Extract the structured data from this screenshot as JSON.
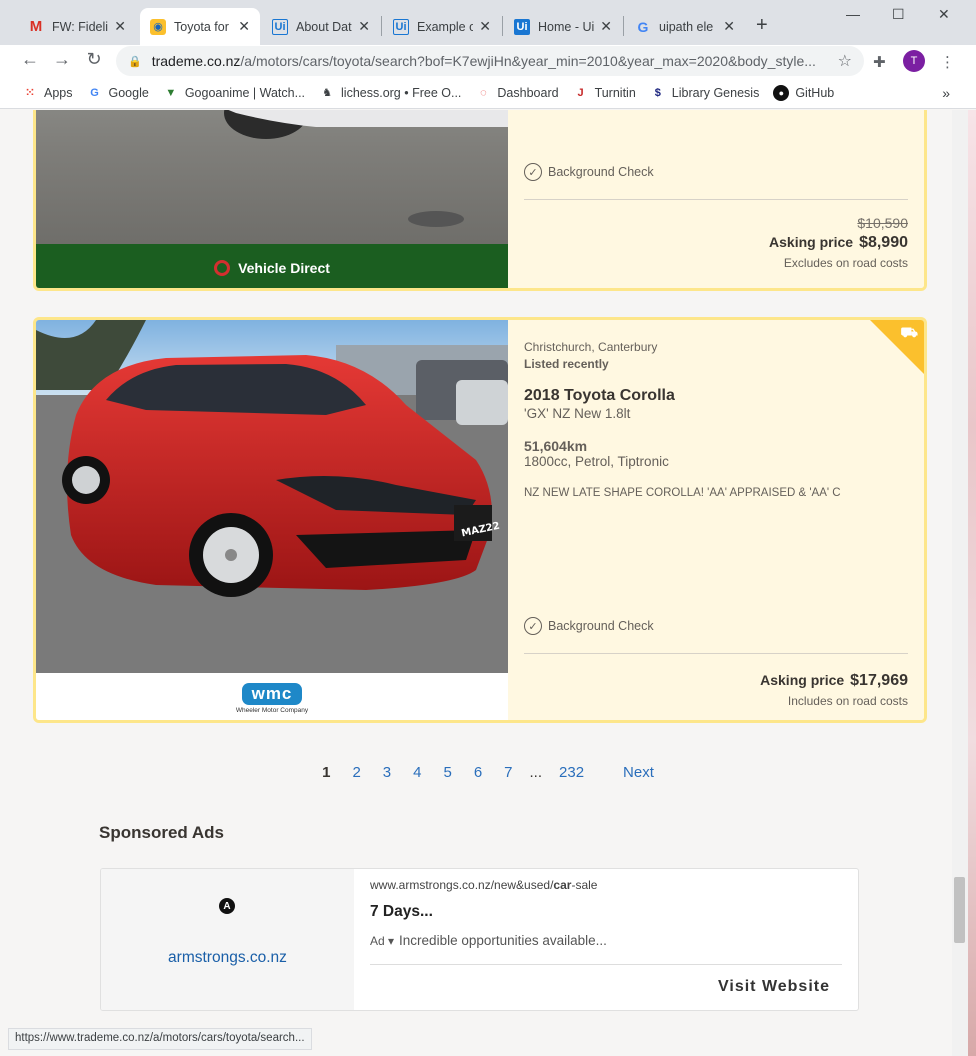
{
  "browser": {
    "tabs": [
      {
        "title": "FW: Fidelity",
        "favicon": "gmail-icon"
      },
      {
        "title": "Toyota for",
        "favicon": "trademe-icon"
      },
      {
        "title": "About Dat",
        "favicon": "uipath-icon"
      },
      {
        "title": "Example o",
        "favicon": "uipath-icon"
      },
      {
        "title": "Home - Ui",
        "favicon": "uipath-icon"
      },
      {
        "title": "uipath ele",
        "favicon": "google-icon"
      }
    ],
    "url_host": "trademe.co.nz",
    "url_path": "/a/motors/cars/toyota/search?bof=K7ewjiHn&year_min=2010&year_max=2020&body_style...",
    "profile_initial": "T",
    "bookmarks": [
      "Apps",
      "Google",
      "Gogoanime | Watch...",
      "lichess.org • Free O...",
      "Dashboard",
      "Turnitin",
      "Library Genesis",
      "GitHub"
    ],
    "status_url": "https://www.trademe.co.nz/a/motors/cars/toyota/search..."
  },
  "listing1": {
    "dealer": "Vehicle Direct",
    "background_check": "Background Check",
    "old_price": "$10,590",
    "asking_label": "Asking price",
    "price": "$8,990",
    "road_costs": "Excludes on road costs"
  },
  "listing2": {
    "location": "Christchurch, Canterbury",
    "listed": "Listed recently",
    "title": "2018 Toyota Corolla",
    "subtitle": "'GX' NZ New 1.8lt",
    "km": "51,604km",
    "specs": "1800cc, Petrol, Tiptronic",
    "description": "NZ NEW LATE SHAPE COROLLA! 'AA' APPRAISED & 'AA' C",
    "background_check": "Background Check",
    "asking_label": "Asking price",
    "price": "$17,969",
    "road_costs": "Includes on road costs",
    "dealer_logo": "wmc",
    "dealer_tagline": "Wheeler Motor Company",
    "plate": "MAZ22"
  },
  "pagination": {
    "pages": [
      "1",
      "2",
      "3",
      "4",
      "5",
      "6",
      "7"
    ],
    "ellipsis": "...",
    "last": "232",
    "next": "Next"
  },
  "sponsored": {
    "heading": "Sponsored Ads",
    "logo_letter": "A",
    "domain": "armstrongs.co.nz",
    "url_prefix": "www.armstrongs.co.nz/new&used/",
    "url_bold": "car",
    "url_suffix": "-sale",
    "headline": "7 Days...",
    "ad_tag": "Ad ▾",
    "text": "Incredible opportunities available...",
    "cta": "Visit Website"
  }
}
